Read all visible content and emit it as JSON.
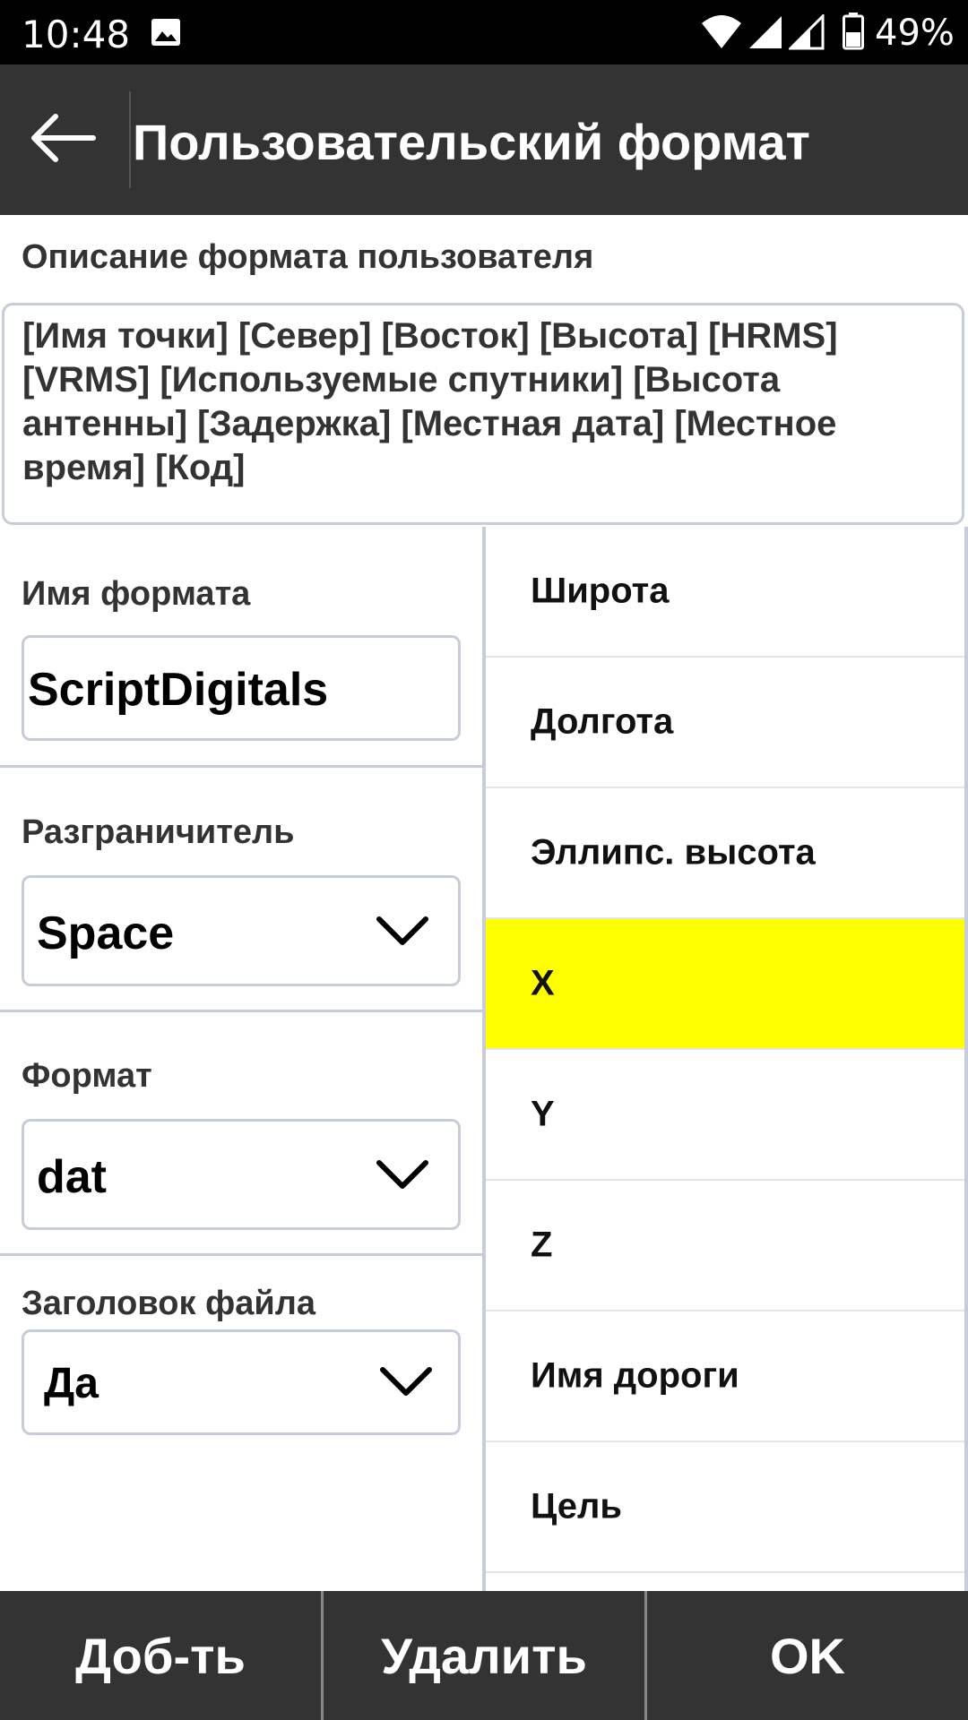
{
  "status_bar": {
    "time": "10:48",
    "battery_percent": "49%",
    "icons": [
      "image-icon",
      "wifi-icon",
      "cell-signal-icon",
      "cell-signal-icon",
      "battery-icon"
    ]
  },
  "app_bar": {
    "title": "Пользовательский формат",
    "back_icon": "arrow-left-icon"
  },
  "description": {
    "label": "Описание формата пользователя",
    "value": "[Имя точки] [Север] [Восток] [Высота] [HRMS] [VRMS] [Используемые спутники] [Высота антенны] [Задержка] [Местная дата] [Местное время] [Код]"
  },
  "fields": {
    "format_name": {
      "label": "Имя формата",
      "value": "ScriptDigitals"
    },
    "delimiter": {
      "label": "Разграничитель",
      "value": "Space"
    },
    "format": {
      "label": "Формат",
      "value": "dat"
    },
    "file_header": {
      "label": "Заголовок файла",
      "value": "Да"
    }
  },
  "list": {
    "items": [
      "Широта",
      "Долгота",
      "Эллипс. высота",
      "X",
      "Y",
      "Z",
      "Имя дороги",
      "Цель"
    ],
    "selected": "X",
    "selected_color": "#ffff00"
  },
  "buttons": {
    "add": "Доб-ть",
    "delete": "Удалить",
    "ok": "OK"
  },
  "colors": {
    "app_bar": "#333333",
    "status_bar": "#000000",
    "highlight": "#ffff00"
  }
}
